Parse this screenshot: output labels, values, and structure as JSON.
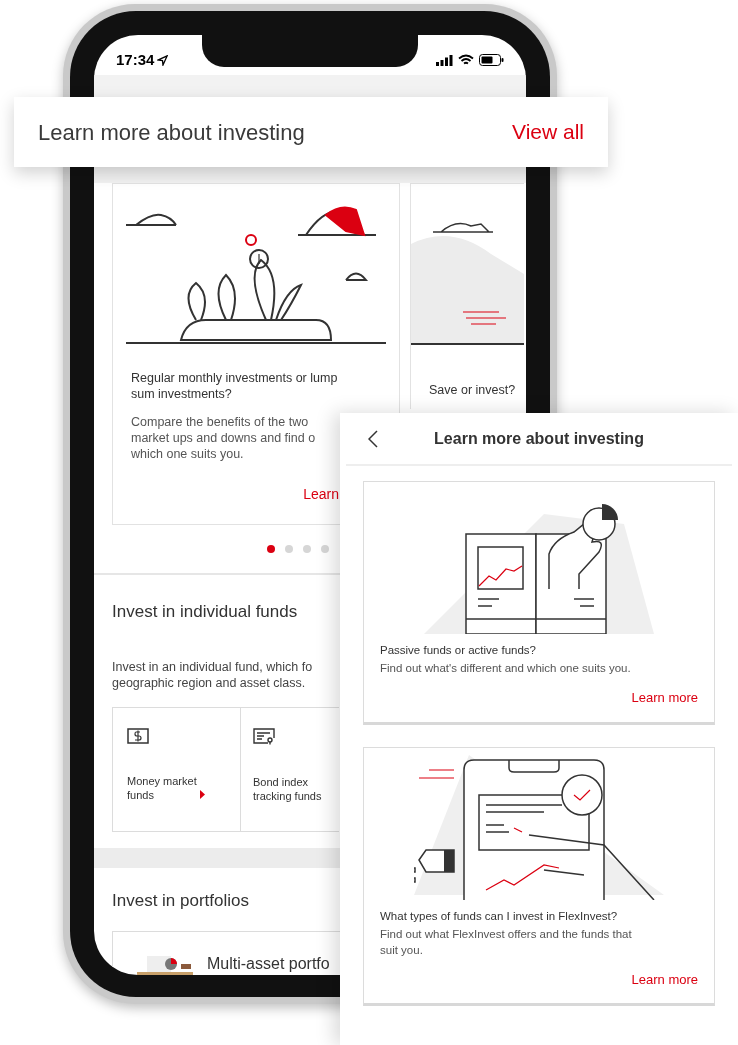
{
  "status_bar": {
    "time": "17:34"
  },
  "header": {
    "title": "Learn more about investing",
    "link": "View all"
  },
  "carousel": {
    "cards": [
      {
        "title": "Regular monthly investments or lump sum investments?",
        "body_lines": [
          "Compare the benefits of the two",
          "market ups and downs and find o",
          "which one suits you."
        ],
        "link": "Learn"
      },
      {
        "title": "Save or invest?"
      }
    ],
    "dots": [
      {
        "selected": true
      },
      {
        "selected": false
      },
      {
        "selected": false
      },
      {
        "selected": false
      }
    ]
  },
  "individual_funds": {
    "title": "Invest in individual funds",
    "description_lines": [
      "Invest in an individual fund, which fo",
      "geographic region and asset class."
    ],
    "tiles": [
      {
        "kind": "cash",
        "label": "Money market funds",
        "arrow": true
      },
      {
        "kind": "document",
        "label": "Bond index tracking funds",
        "arrow": false
      }
    ]
  },
  "portfolios": {
    "title": "Invest in portfolios",
    "card": {
      "title": "Multi-asset portfo"
    }
  },
  "panel": {
    "title": "Learn more about investing",
    "articles": [
      {
        "kind": "book",
        "title": "Passive funds or active funds?",
        "body": "Find out what's different and which one suits you.",
        "link": "Learn more"
      },
      {
        "kind": "tablet",
        "title": "What types of funds can I invest in FlexInvest?",
        "body": "Find out what FlexInvest offers and the funds that suit you.",
        "link": "Learn more"
      }
    ]
  }
}
